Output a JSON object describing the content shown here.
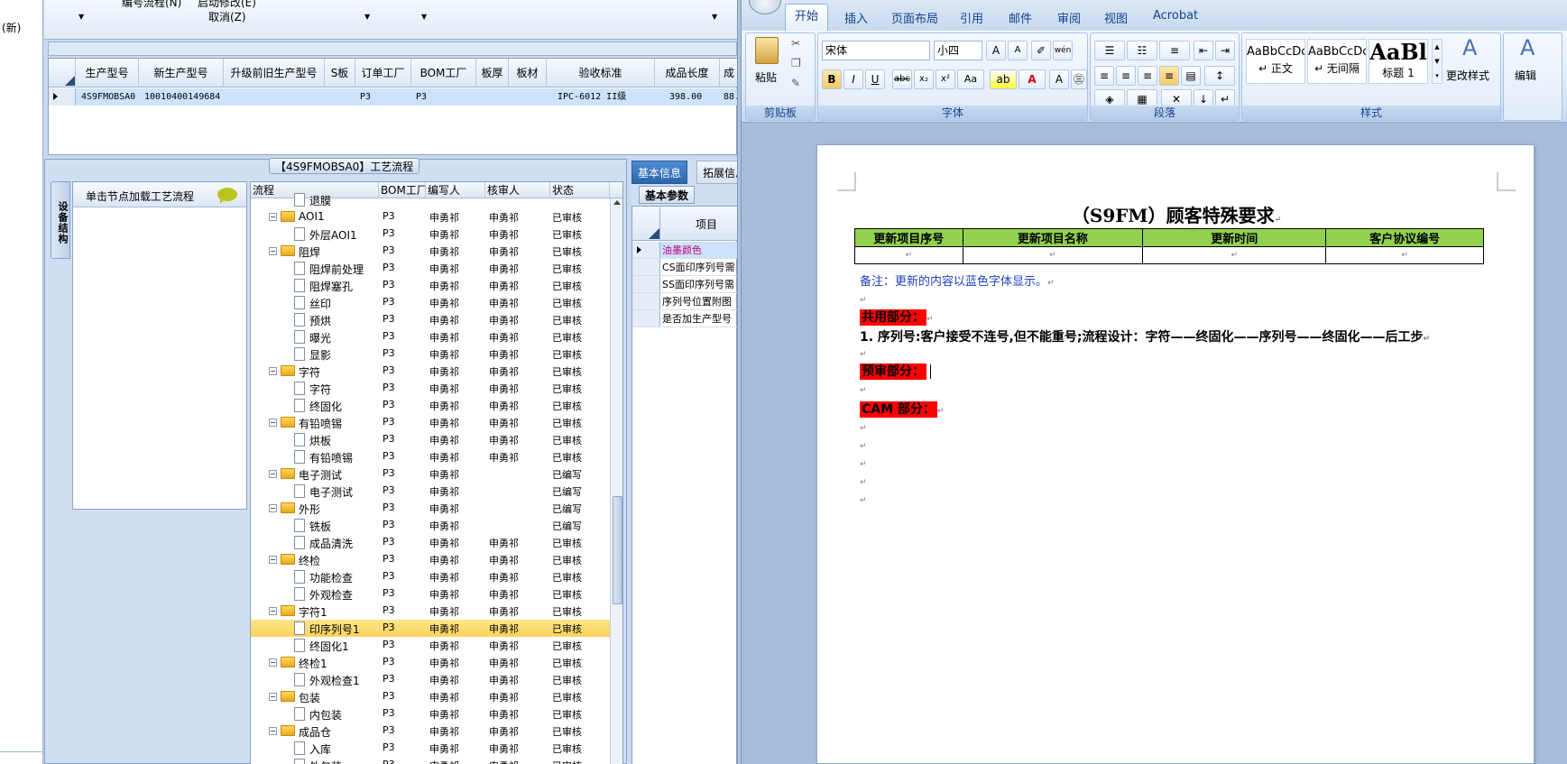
{
  "left_strip": {
    "tag": "(新)"
  },
  "top_menu": {
    "items": [
      "编号流程(N)",
      "启动修改(E)",
      "取消(Z)"
    ]
  },
  "product_grid": {
    "columns": [
      "生产型号",
      "新生产型号",
      "升级前旧生产型号",
      "S板",
      "订单工厂",
      "BOM工厂",
      "板厚",
      "板材",
      "验收标准",
      "成品长度",
      "成"
    ],
    "row": [
      "4S9FMOBSA0",
      "10010400149684",
      "",
      "",
      "P3",
      "P3",
      "",
      "",
      "IPC-6012 II级",
      "398.00",
      "88."
    ]
  },
  "process_panel": {
    "title": "【4S9FMOBSA0】工艺流程",
    "side_tab": "设备结构",
    "load_hint": "单击节点加载工艺流程",
    "tree_columns": [
      "流程",
      "BOM工厂",
      "编写人",
      "核审人",
      "状态"
    ],
    "rows": [
      {
        "level": 2,
        "type": "doc",
        "name": "退膜",
        "bom": "",
        "writer": "",
        "reviewer": "",
        "status": ""
      },
      {
        "level": 1,
        "type": "folder",
        "name": "AOI1",
        "bom": "P3",
        "writer": "申勇祁",
        "reviewer": "申勇祁",
        "status": "已审核"
      },
      {
        "level": 2,
        "type": "doc",
        "name": "外层AOI1",
        "bom": "P3",
        "writer": "申勇祁",
        "reviewer": "申勇祁",
        "status": "已审核"
      },
      {
        "level": 1,
        "type": "folder",
        "name": "阻焊",
        "bom": "P3",
        "writer": "申勇祁",
        "reviewer": "申勇祁",
        "status": "已审核"
      },
      {
        "level": 2,
        "type": "doc",
        "name": "阻焊前处理",
        "bom": "P3",
        "writer": "申勇祁",
        "reviewer": "申勇祁",
        "status": "已审核"
      },
      {
        "level": 2,
        "type": "doc",
        "name": "阻焊塞孔",
        "bom": "P3",
        "writer": "申勇祁",
        "reviewer": "申勇祁",
        "status": "已审核"
      },
      {
        "level": 2,
        "type": "doc",
        "name": "丝印",
        "bom": "P3",
        "writer": "申勇祁",
        "reviewer": "申勇祁",
        "status": "已审核"
      },
      {
        "level": 2,
        "type": "doc",
        "name": "预烘",
        "bom": "P3",
        "writer": "申勇祁",
        "reviewer": "申勇祁",
        "status": "已审核"
      },
      {
        "level": 2,
        "type": "doc",
        "name": "曝光",
        "bom": "P3",
        "writer": "申勇祁",
        "reviewer": "申勇祁",
        "status": "已审核"
      },
      {
        "level": 2,
        "type": "doc",
        "name": "显影",
        "bom": "P3",
        "writer": "申勇祁",
        "reviewer": "申勇祁",
        "status": "已审核"
      },
      {
        "level": 1,
        "type": "folder",
        "name": "字符",
        "bom": "P3",
        "writer": "申勇祁",
        "reviewer": "申勇祁",
        "status": "已审核"
      },
      {
        "level": 2,
        "type": "doc",
        "name": "字符",
        "bom": "P3",
        "writer": "申勇祁",
        "reviewer": "申勇祁",
        "status": "已审核"
      },
      {
        "level": 2,
        "type": "doc",
        "name": "终固化",
        "bom": "P3",
        "writer": "申勇祁",
        "reviewer": "申勇祁",
        "status": "已审核"
      },
      {
        "level": 1,
        "type": "folder",
        "name": "有铅喷锡",
        "bom": "P3",
        "writer": "申勇祁",
        "reviewer": "申勇祁",
        "status": "已审核"
      },
      {
        "level": 2,
        "type": "doc",
        "name": "烘板",
        "bom": "P3",
        "writer": "申勇祁",
        "reviewer": "申勇祁",
        "status": "已审核"
      },
      {
        "level": 2,
        "type": "doc",
        "name": "有铅喷锡",
        "bom": "P3",
        "writer": "申勇祁",
        "reviewer": "申勇祁",
        "status": "已审核"
      },
      {
        "level": 1,
        "type": "folder",
        "name": "电子测试",
        "bom": "P3",
        "writer": "申勇祁",
        "reviewer": "",
        "status": "已编写"
      },
      {
        "level": 2,
        "type": "doc",
        "name": "电子测试",
        "bom": "P3",
        "writer": "申勇祁",
        "reviewer": "",
        "status": "已编写"
      },
      {
        "level": 1,
        "type": "folder",
        "name": "外形",
        "bom": "P3",
        "writer": "申勇祁",
        "reviewer": "",
        "status": "已编写"
      },
      {
        "level": 2,
        "type": "doc",
        "name": "铣板",
        "bom": "P3",
        "writer": "申勇祁",
        "reviewer": "",
        "status": "已编写"
      },
      {
        "level": 2,
        "type": "doc",
        "name": "成品清洗",
        "bom": "P3",
        "writer": "申勇祁",
        "reviewer": "申勇祁",
        "status": "已审核"
      },
      {
        "level": 1,
        "type": "folder",
        "name": "终检",
        "bom": "P3",
        "writer": "申勇祁",
        "reviewer": "申勇祁",
        "status": "已审核"
      },
      {
        "level": 2,
        "type": "doc",
        "name": "功能检查",
        "bom": "P3",
        "writer": "申勇祁",
        "reviewer": "申勇祁",
        "status": "已审核"
      },
      {
        "level": 2,
        "type": "doc",
        "name": "外观检查",
        "bom": "P3",
        "writer": "申勇祁",
        "reviewer": "申勇祁",
        "status": "已审核"
      },
      {
        "level": 1,
        "type": "folder",
        "name": "字符1",
        "bom": "P3",
        "writer": "申勇祁",
        "reviewer": "申勇祁",
        "status": "已审核"
      },
      {
        "level": 2,
        "type": "doc",
        "name": "印序列号1",
        "bom": "P3",
        "writer": "申勇祁",
        "reviewer": "申勇祁",
        "status": "已审核",
        "selected": true
      },
      {
        "level": 2,
        "type": "doc",
        "name": "终固化1",
        "bom": "P3",
        "writer": "申勇祁",
        "reviewer": "申勇祁",
        "status": "已审核"
      },
      {
        "level": 1,
        "type": "folder",
        "name": "终检1",
        "bom": "P3",
        "writer": "申勇祁",
        "reviewer": "申勇祁",
        "status": "已审核"
      },
      {
        "level": 2,
        "type": "doc",
        "name": "外观检查1",
        "bom": "P3",
        "writer": "申勇祁",
        "reviewer": "申勇祁",
        "status": "已审核"
      },
      {
        "level": 1,
        "type": "folder",
        "name": "包装",
        "bom": "P3",
        "writer": "申勇祁",
        "reviewer": "申勇祁",
        "status": "已审核"
      },
      {
        "level": 2,
        "type": "doc",
        "name": "内包装",
        "bom": "P3",
        "writer": "申勇祁",
        "reviewer": "申勇祁",
        "status": "已审核"
      },
      {
        "level": 1,
        "type": "folder",
        "name": "成品仓",
        "bom": "P3",
        "writer": "申勇祁",
        "reviewer": "申勇祁",
        "status": "已审核"
      },
      {
        "level": 2,
        "type": "doc",
        "name": "入库",
        "bom": "P3",
        "writer": "申勇祁",
        "reviewer": "申勇祁",
        "status": "已审核"
      },
      {
        "level": 2,
        "type": "doc",
        "name": "外包装",
        "bom": "P3",
        "writer": "申勇祁",
        "reviewer": "申勇祁",
        "status": "已审核"
      }
    ]
  },
  "info_pane": {
    "tabs": [
      "基本信息",
      "拓展信息"
    ],
    "subtab": "基本参数",
    "col_header": "项目",
    "rows": [
      "油墨颜色",
      "CS面印序列号需",
      "SS面印序列号需",
      "序列号位置附图",
      "是否加生产型号"
    ],
    "highlight_color": "#c0007a"
  },
  "word": {
    "tabs": [
      "开始",
      "插入",
      "页面布局",
      "引用",
      "邮件",
      "审阅",
      "视图",
      "Acrobat"
    ],
    "clipboard": {
      "paste": "粘贴",
      "label": "剪贴板"
    },
    "font": {
      "name": "宋体",
      "size": "小四",
      "label": "字体"
    },
    "paragraph": {
      "label": "段落"
    },
    "styles": {
      "items": [
        {
          "preview": "AaBbCcDc",
          "name": "↵ 正文"
        },
        {
          "preview": "AaBbCcDc",
          "name": "↵ 无间隔"
        },
        {
          "preview": "AaBl",
          "name": "标题 1"
        }
      ],
      "change": "更改样式",
      "label": "样式"
    },
    "edit": {
      "label": "编辑"
    },
    "doc": {
      "title": "（S9FM）顾客特殊要求",
      "table_headers": [
        "更新项目序号",
        "更新项目名称",
        "更新时间",
        "客户协议编号"
      ],
      "note": "备注：更新的内容以蓝色字体显示。",
      "common": "共用部分：",
      "line1": "1. 序列号:客户接受不连号,但不能重号;流程设计：字符——终固化——序列号——终固化——后工步",
      "pre_review": "预审部分：",
      "cam": "CAM 部分：",
      "para_mark": "↵"
    }
  }
}
